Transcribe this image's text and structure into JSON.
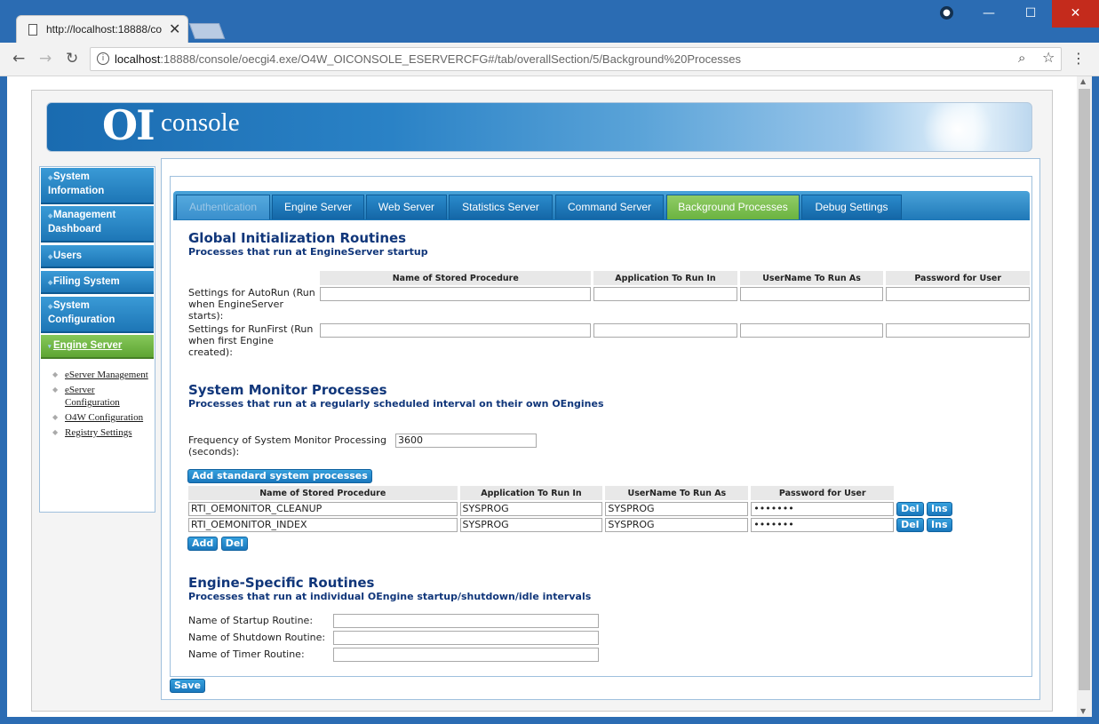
{
  "browser": {
    "tab_title": "http://localhost:18888/co",
    "tab_close": "✕",
    "url_host": "localhost",
    "url_rest": ":18888/console/oecgi4.exe/O4W_OICONSOLE_ESERVERCFG#/tab/overallSection/5/Background%20Processes",
    "win_min": "—",
    "win_max": "☐",
    "win_close": "✕",
    "icons": {
      "back": "arrow-left-icon",
      "forward": "arrow-right-icon",
      "reload": "reload-icon",
      "info": "info-icon",
      "zoom": "zoom-icon",
      "star": "star-icon",
      "menu": "kebab-menu-icon"
    }
  },
  "banner": {
    "logo_oi": "OI",
    "logo_console": "console"
  },
  "sidebar": {
    "items": [
      {
        "label": "System Information"
      },
      {
        "label": "Management Dashboard"
      },
      {
        "label": "Users"
      },
      {
        "label": "Filing System"
      },
      {
        "label": "System Configuration"
      },
      {
        "label": "Engine Server"
      }
    ],
    "subitems": [
      {
        "label": "eServer Management"
      },
      {
        "label": "eServer Configuration"
      },
      {
        "label": "O4W Configuration"
      },
      {
        "label": "Registry Settings"
      }
    ]
  },
  "tabs": [
    {
      "label": "Authentication"
    },
    {
      "label": "Engine Server"
    },
    {
      "label": "Web Server"
    },
    {
      "label": "Statistics Server"
    },
    {
      "label": "Command Server"
    },
    {
      "label": "Background Processes"
    },
    {
      "label": "Debug Settings"
    }
  ],
  "global": {
    "title": "Global Initialization Routines",
    "subtitle": "Processes that run at EngineServer startup",
    "columns": [
      "Name of Stored Procedure",
      "Application To Run In",
      "UserName To Run As",
      "Password for User"
    ],
    "rows": [
      {
        "label": "Settings for AutoRun (Run when EngineServer starts):",
        "values": [
          "",
          "",
          "",
          ""
        ]
      },
      {
        "label": "Settings for RunFirst (Run when first Engine created):",
        "values": [
          "",
          "",
          "",
          ""
        ]
      }
    ]
  },
  "monitor": {
    "title": "System Monitor Processes",
    "subtitle": "Processes that run at a regularly scheduled interval on their own OEngines",
    "frequency_label": "Frequency of System Monitor Processing (seconds):",
    "frequency_value": "3600",
    "add_standard_label": "Add standard system processes",
    "columns": [
      "Name of Stored Procedure",
      "Application To Run In",
      "UserName To Run As",
      "Password for User"
    ],
    "rows": [
      {
        "proc": "RTI_OEMONITOR_CLEANUP",
        "app": "SYSPROG",
        "user": "SYSPROG",
        "password": "•••••••"
      },
      {
        "proc": "RTI_OEMONITOR_INDEX",
        "app": "SYSPROG",
        "user": "SYSPROG",
        "password": "•••••••"
      }
    ],
    "del_label": "Del",
    "ins_label": "Ins",
    "add_label": "Add"
  },
  "engine": {
    "title": "Engine-Specific Routines",
    "subtitle": "Processes that run at individual OEngine startup/shutdown/idle intervals",
    "startup_label": "Name of Startup Routine:",
    "shutdown_label": "Name of Shutdown Routine:",
    "timer_label": "Name of Timer Routine:",
    "startup_value": "",
    "shutdown_value": "",
    "timer_value": ""
  },
  "save_label": "Save"
}
